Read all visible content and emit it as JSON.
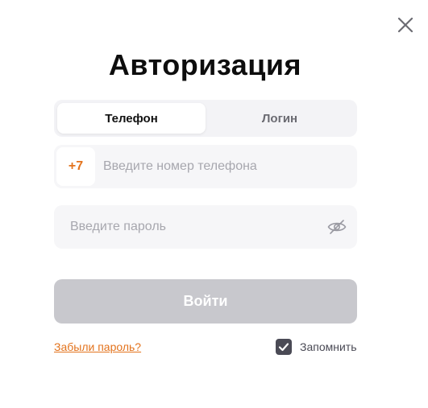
{
  "dialog": {
    "title": "Авторизация",
    "close_icon": "close-icon"
  },
  "tabs": [
    {
      "label": "Телефон",
      "active": true
    },
    {
      "label": "Логин",
      "active": false
    }
  ],
  "phone": {
    "prefix": "+7",
    "placeholder": "Введите номер телефона",
    "value": ""
  },
  "password": {
    "placeholder": "Введите пароль",
    "value": "",
    "toggle_icon": "eye-off-icon"
  },
  "submit": {
    "label": "Войти"
  },
  "forgot": {
    "label": "Забыли пароль?"
  },
  "remember": {
    "label": "Запомнить",
    "checked": true
  },
  "colors": {
    "accent": "#e3731d",
    "button_disabled": "#c8c8cd",
    "field_bg": "#f6f6f8",
    "checkbox": "#4a4a55"
  }
}
